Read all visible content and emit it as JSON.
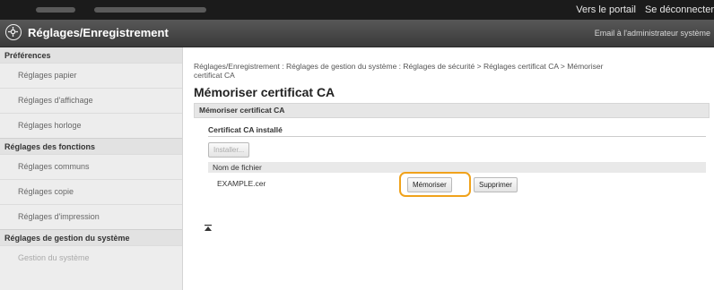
{
  "topbar": {
    "portal_link": "Vers le portail",
    "logout_link": "Se déconnecter"
  },
  "header": {
    "title": "Réglages/Enregistrement",
    "admin_mail": "Email à l'administrateur système",
    "logo_icon": "settings-gear-icon"
  },
  "sidebar": {
    "sections": [
      {
        "title": "Préférences",
        "items": [
          "Réglages papier",
          "Réglages d'affichage",
          "Réglages horloge"
        ]
      },
      {
        "title": "Réglages des fonctions",
        "items": [
          "Réglages communs",
          "Réglages copie",
          "Réglages d'impression"
        ]
      },
      {
        "title": "Réglages de gestion du système",
        "items": [
          "Gestion du système"
        ]
      }
    ]
  },
  "main": {
    "breadcrumb_line1": "Réglages/Enregistrement : Réglages de gestion du système : Réglages de sécurité > Réglages certificat CA > Mémoriser",
    "breadcrumb_line2": "certificat CA",
    "page_title": "Mémoriser certificat CA",
    "section_title": "Mémoriser certificat CA",
    "installed_heading": "Certificat CA installé",
    "install_button": "Installer...",
    "file_name_label": "Nom de fichier",
    "file_name_value": "EXAMPLE.cer",
    "register_button": "Mémoriser",
    "delete_button": "Supprimer",
    "highlight_color": "#f0a21b"
  }
}
